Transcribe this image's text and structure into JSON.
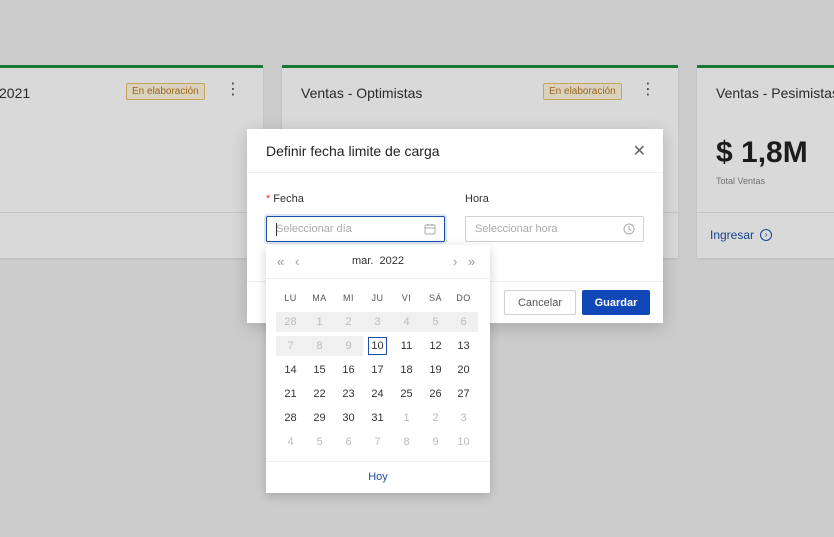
{
  "cards": [
    {
      "title": "2021",
      "badge": "En elaboración"
    },
    {
      "title": "Ventas - Optimistas",
      "badge": "En elaboración"
    },
    {
      "title": "Ventas - Pesimistas",
      "amount": "$ 1,8M",
      "amount_label": "Total Ventas",
      "link": "Ingresar"
    }
  ],
  "modal": {
    "title": "Definir fecha limite de carga",
    "date_label": "Fecha",
    "date_placeholder": "Seleccionar día",
    "time_label": "Hora",
    "time_placeholder": "Seleccionar hora",
    "cancel": "Cancelar",
    "save": "Guardar"
  },
  "calendar": {
    "month": "mar.",
    "year": "2022",
    "weekdays": [
      "LU",
      "MA",
      "MI",
      "JU",
      "VI",
      "SÁ",
      "DO"
    ],
    "weeks": [
      [
        "28",
        "1",
        "2",
        "3",
        "4",
        "5",
        "6"
      ],
      [
        "7",
        "8",
        "9",
        "10",
        "11",
        "12",
        "13"
      ],
      [
        "14",
        "15",
        "16",
        "17",
        "18",
        "19",
        "20"
      ],
      [
        "21",
        "22",
        "23",
        "24",
        "25",
        "26",
        "27"
      ],
      [
        "28",
        "29",
        "30",
        "31",
        "1",
        "2",
        "3"
      ],
      [
        "4",
        "5",
        "6",
        "7",
        "8",
        "9",
        "10"
      ]
    ],
    "today_button": "Hoy",
    "selected_today": "10"
  },
  "colors": {
    "primary": "#1048b8",
    "accent_green": "#1e8e3e",
    "badge": "#b7791f"
  }
}
